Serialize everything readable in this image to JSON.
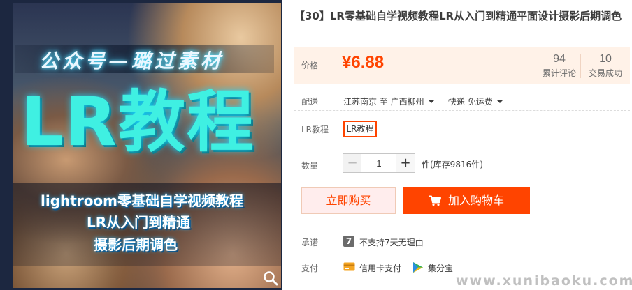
{
  "image": {
    "subtitle": "公众号—璐过素材",
    "title": "LR教程",
    "line1": "lightroom零基础自学视频教程",
    "line2": "LR从入门到精通",
    "line3": "摄影后期调色"
  },
  "product": {
    "title": "【30】LR零基础自学视频教程LR从入门到精通平面设计摄影后期调色"
  },
  "price": {
    "label": "价格",
    "value": "¥6.88",
    "reviews_count": "94",
    "reviews_label": "累计评论",
    "deals_count": "10",
    "deals_label": "交易成功"
  },
  "shipping": {
    "label": "配送",
    "route": "江苏南京 至  广西柳州",
    "method": "快递 免运费"
  },
  "variant": {
    "label": "LR教程",
    "selected": "LR教程"
  },
  "quantity": {
    "label": "数量",
    "minus": "−",
    "value": "1",
    "plus": "+",
    "stock": "件(库存9816件)"
  },
  "buttons": {
    "buy_now": "立即购买",
    "add_to_cart": "加入购物车"
  },
  "promise": {
    "label": "承诺",
    "badge": "7",
    "text": "不支持7天无理由"
  },
  "payment": {
    "label": "支付",
    "credit_card": "信用卡支付",
    "jifenbao": "集分宝"
  },
  "watermark": "www.xunibaoku.com",
  "colors": {
    "accent": "#ff4400",
    "price_panel_bg": "#fff2e8",
    "buy_now_bg": "#ffeded"
  }
}
